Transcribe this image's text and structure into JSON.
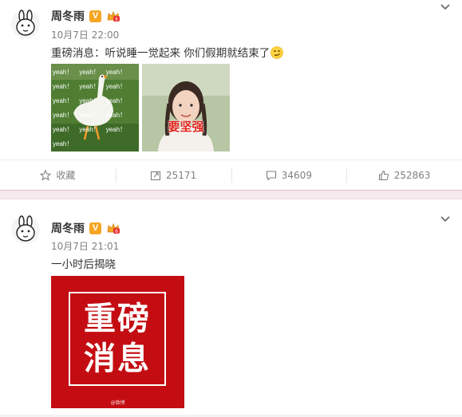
{
  "posts": [
    {
      "user": {
        "name": "周冬雨",
        "verified_badge": "V"
      },
      "time": "10月7日 22:00",
      "text": "重磅消息：听说睡一觉起来 你们假期就结束了",
      "images": [
        {
          "overlay_words": [
            "yeah！",
            "yeah！",
            "yeah！",
            "yeah！",
            "yeah！",
            "yeah！",
            "yeah！",
            "yeah！",
            "yeah！",
            "yeah！",
            "yeah！",
            "yeah！",
            "yeah！",
            "yeah！",
            "yeah！",
            "yeah！"
          ]
        },
        {
          "caption": "要坚强"
        }
      ],
      "actions": {
        "favorite": "收藏",
        "repost": "25171",
        "comment": "34609",
        "like": "252863"
      }
    },
    {
      "user": {
        "name": "周冬雨",
        "verified_badge": "V"
      },
      "time": "10月7日 21:01",
      "text": "一小时后揭晓",
      "image": {
        "line1": "重磅",
        "line2": "消息",
        "watermark": "@微博"
      }
    }
  ],
  "colors": {
    "accent": "#f5a623",
    "poster_red": "#c40d12",
    "divider_pink": "#f5e9ee"
  },
  "icons": [
    "rabbit-avatar-icon",
    "chevron-down-icon",
    "member-crown-icon",
    "smirk-emoji-icon",
    "star-icon",
    "repost-icon",
    "comment-icon",
    "like-icon"
  ]
}
